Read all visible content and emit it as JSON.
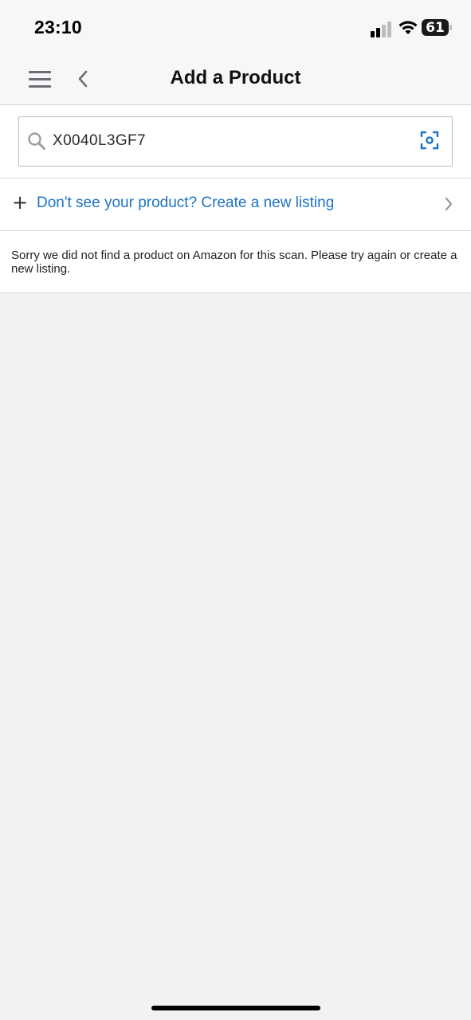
{
  "status_bar": {
    "time": "23:10",
    "battery_level": "61",
    "signal_icon": "cellular-signal-icon",
    "wifi_icon": "wifi-icon"
  },
  "header": {
    "title": "Add a Product",
    "menu_icon": "hamburger-menu-icon",
    "back_icon": "chevron-left-icon"
  },
  "search": {
    "value": "X0040L3GF7",
    "search_icon": "search-icon",
    "scan_icon": "barcode-scan-icon"
  },
  "create_listing": {
    "label": "Don't see your product? Create a new listing",
    "plus_icon": "plus-icon",
    "chevron_icon": "chevron-right-icon"
  },
  "message": {
    "text": "Sorry we did not find a product on Amazon for this scan. Please try again or create a new listing."
  },
  "colors": {
    "accent": "#1d73c4",
    "background": "#f1f2f4",
    "surface": "#ffffff"
  }
}
